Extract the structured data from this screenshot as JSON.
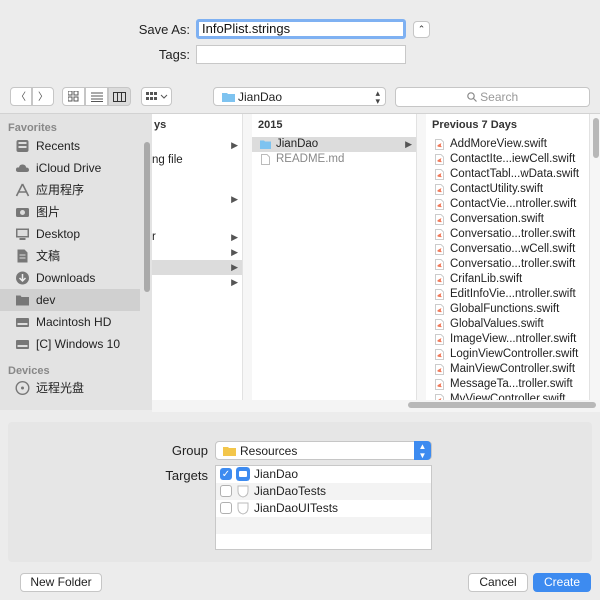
{
  "save_area": {
    "save_as_label": "Save As:",
    "filename_value": "InfoPlist.strings",
    "tags_label": "Tags:",
    "collapse_glyph": "⌃"
  },
  "toolbar": {
    "back_glyph": "〈",
    "forward_glyph": "〉",
    "path_folder": "JianDao",
    "search_placeholder": "Search"
  },
  "sidebar": {
    "favorites_header": "Favorites",
    "favorites": [
      {
        "label": "Recents",
        "icon": "clock-icon"
      },
      {
        "label": "iCloud Drive",
        "icon": "cloud-icon"
      },
      {
        "label": "应用程序",
        "icon": "applications-icon"
      },
      {
        "label": "图片",
        "icon": "camera-icon"
      },
      {
        "label": "Desktop",
        "icon": "desktop-icon"
      },
      {
        "label": "文稿",
        "icon": "document-icon"
      },
      {
        "label": "Downloads",
        "icon": "download-icon"
      },
      {
        "label": "dev",
        "icon": "folder-icon"
      },
      {
        "label": "Macintosh HD",
        "icon": "disk-icon"
      },
      {
        "label": "[C] Windows 10",
        "icon": "disk-icon"
      }
    ],
    "devices_header": "Devices",
    "devices": [
      {
        "label": "远程光盘",
        "icon": "disc-icon"
      }
    ]
  },
  "columns": {
    "col1": {
      "header": "ys",
      "rows": [
        "",
        "ng file",
        "",
        "",
        "",
        "",
        "r",
        "",
        ""
      ]
    },
    "col2": {
      "header": "2015",
      "rows": [
        {
          "label": "JianDao",
          "type": "folder"
        },
        {
          "label": "README.md",
          "type": "file"
        }
      ]
    },
    "col3": {
      "header": "Previous 7 Days",
      "rows": [
        "AddMoreView.swift",
        "ContactIte...iewCell.swift",
        "ContactTabl...wData.swift",
        "ContactUtility.swift",
        "ContactVie...ntroller.swift",
        "Conversation.swift",
        "Conversatio...troller.swift",
        "Conversatio...wCell.swift",
        "Conversatio...troller.swift",
        "CrifanLib.swift",
        "EditInfoVie...ntroller.swift",
        "GlobalFunctions.swift",
        "GlobalValues.swift",
        "ImageView...ntroller.swift",
        "LoginViewController.swift",
        "MainViewController.swift",
        "MessageTa...troller.swift",
        "MyViewController.swift"
      ]
    }
  },
  "options": {
    "group_label": "Group",
    "group_value": "Resources",
    "targets_label": "Targets",
    "targets": [
      {
        "label": "JianDao",
        "checked": true
      },
      {
        "label": "JianDaoTests",
        "checked": false
      },
      {
        "label": "JianDaoUITests",
        "checked": false
      }
    ]
  },
  "buttons": {
    "new_folder": "New Folder",
    "cancel": "Cancel",
    "create": "Create"
  },
  "colors": {
    "accent": "#3d8bf0",
    "focus_ring": "#7fb1f2",
    "selection_gray": "#dcdcdc"
  }
}
